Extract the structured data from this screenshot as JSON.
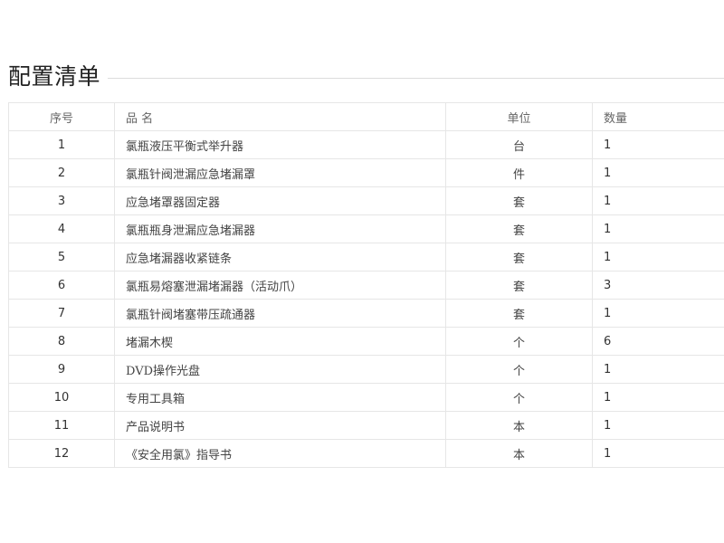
{
  "page_title": "配置清单",
  "table": {
    "headers": {
      "index": "序号",
      "name": "品 名",
      "unit": "单位",
      "quantity": "数量"
    },
    "rows": [
      {
        "index": "1",
        "name": "氯瓶液压平衡式举升器",
        "unit": "台",
        "quantity": "1"
      },
      {
        "index": "2",
        "name": "氯瓶针阀泄漏应急堵漏罩",
        "unit": "件",
        "quantity": "1"
      },
      {
        "index": "3",
        "name": "应急堵罩器固定器",
        "unit": "套",
        "quantity": "1"
      },
      {
        "index": "4",
        "name": "氯瓶瓶身泄漏应急堵漏器",
        "unit": "套",
        "quantity": "1"
      },
      {
        "index": "5",
        "name": "应急堵漏器收紧链条",
        "unit": "套",
        "quantity": "1"
      },
      {
        "index": "6",
        "name": "氯瓶易熔塞泄漏堵漏器（活动爪）",
        "unit": "套",
        "quantity": "3"
      },
      {
        "index": "7",
        "name": "氯瓶针阀堵塞带压疏通器",
        "unit": "套",
        "quantity": "1"
      },
      {
        "index": "8",
        "name": "堵漏木楔",
        "unit": "个",
        "quantity": "6"
      },
      {
        "index": "9",
        "name": "DVD操作光盘",
        "unit": "个",
        "quantity": "1"
      },
      {
        "index": "10",
        "name": "专用工具箱",
        "unit": "个",
        "quantity": "1"
      },
      {
        "index": "11",
        "name": "产品说明书",
        "unit": "本",
        "quantity": "1"
      },
      {
        "index": "12",
        "name": "《安全用氯》指导书",
        "unit": "本",
        "quantity": "1"
      }
    ]
  }
}
